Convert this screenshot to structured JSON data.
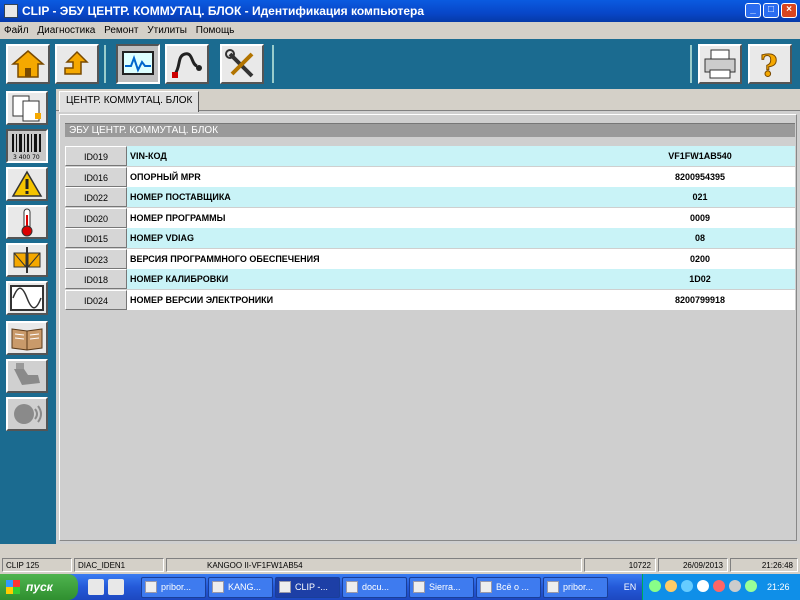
{
  "window": {
    "title": "CLIP - ЭБУ ЦЕНТР. КОММУТАЦ. БЛОК - Идентификация компьютера",
    "buttons": {
      "minimize": "_",
      "maximize": "□",
      "close": "×"
    }
  },
  "menu": [
    "Файл",
    "Диагностика",
    "Ремонт",
    "Утилиты",
    "Помощь"
  ],
  "toolbar": {
    "buttons": [
      {
        "name": "home-icon"
      },
      {
        "name": "back-icon"
      },
      {
        "name": "monitor-icon",
        "selected": true
      },
      {
        "name": "probe-icon"
      },
      {
        "name": "tools-icon"
      },
      {
        "name": "printer-icon"
      },
      {
        "name": "help-icon",
        "label": "?"
      }
    ]
  },
  "sidebar": {
    "items": [
      {
        "name": "identification-icon",
        "selected": false
      },
      {
        "name": "barcode-icon",
        "selected": true,
        "label": "3 400 70"
      },
      {
        "name": "warning-icon",
        "selected": false
      },
      {
        "name": "thermometer-icon",
        "selected": false
      },
      {
        "name": "actuator-icon",
        "selected": false
      },
      {
        "name": "waveform-icon",
        "selected": false
      },
      {
        "name": "manual-book-icon",
        "selected": false
      },
      {
        "name": "parts-icon",
        "selected": false,
        "disabled": true
      },
      {
        "name": "voice-icon",
        "selected": false,
        "disabled": true
      }
    ]
  },
  "tab": {
    "label": "ЦЕНТР. КОММУТАЦ. БЛОК"
  },
  "section": {
    "title": "ЭБУ ЦЕНТР. КОММУТАЦ. БЛОК"
  },
  "rows": [
    {
      "id": "ID019",
      "label": "VIN-КОД",
      "value": "VF1FW1AB540"
    },
    {
      "id": "ID016",
      "label": "ОПОРНЫЙ MPR",
      "value": "8200954395"
    },
    {
      "id": "ID022",
      "label": "НОМЕР ПОСТАВЩИКА",
      "value": "021"
    },
    {
      "id": "ID020",
      "label": "НОМЕР ПРОГРАММЫ",
      "value": "0009"
    },
    {
      "id": "ID015",
      "label": "НОМЕР VDIAG",
      "value": "08"
    },
    {
      "id": "ID023",
      "label": "ВЕРСИЯ ПРОГРАММНОГО ОБЕСПЕЧЕНИЯ",
      "value": "0200"
    },
    {
      "id": "ID018",
      "label": "НОМЕР КАЛИБРОВКИ",
      "value": "1D02"
    },
    {
      "id": "ID024",
      "label": "НОМЕР ВЕРСИИ ЭЛЕКТРОНИКИ",
      "value": "8200799918"
    }
  ],
  "status": {
    "app": "CLIP 125",
    "module": "DIAC_IDEN1",
    "vehicle": "KANGOO II-VF1FW1AB54",
    "code": "10722",
    "date": "26/09/2013",
    "time": "21:26:48"
  },
  "taskbar": {
    "start": "пуск",
    "tasks": [
      {
        "label": "pribor..."
      },
      {
        "label": "KANG..."
      },
      {
        "label": "CLIP -...",
        "active": true
      },
      {
        "label": "docu..."
      },
      {
        "label": "Sierra..."
      },
      {
        "label": "Всё о ..."
      },
      {
        "label": "pribor..."
      }
    ],
    "lang": "EN",
    "clock": "21:26"
  },
  "colors": {
    "toolbar": "#1b6b90",
    "row_alt": "#c9f3f7",
    "titlebar": "#0a5be0"
  }
}
